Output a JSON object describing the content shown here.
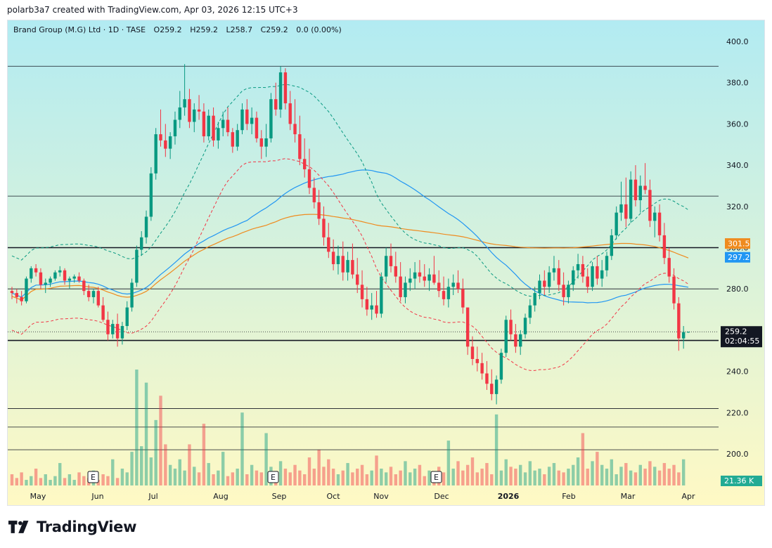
{
  "header": {
    "credit": "polarb3a7 created with TradingView.com, Apr 03, 2026 12:15 UTC+3"
  },
  "legend": {
    "symbol": "Brand Group (M.G) Ltd · 1D · TASE",
    "open": "O259.2",
    "high": "H259.2",
    "low": "L258.7",
    "close": "C259.2",
    "change": "0.0 (0.00%)"
  },
  "brand": {
    "name": "TradingView"
  },
  "colors": {
    "up": "#089981",
    "down": "#f23645",
    "sma_blue": "#2196f3",
    "sma_orange": "#ef8b1f",
    "band_green": "#089981",
    "band_red": "#f23645",
    "bg_top": "#b2ebf2",
    "bg_bottom": "#fff9c4"
  },
  "chart_data": {
    "type": "candlestick",
    "ylim": [
      190,
      405
    ],
    "y_ticks": [
      "400.0",
      "380.0",
      "360.0",
      "340.0",
      "320.0",
      "300.0",
      "280.0",
      "260.0",
      "240.0",
      "220.0",
      "200.0"
    ],
    "x_ticks": [
      "May",
      "Jun",
      "Jul",
      "Aug",
      "Sep",
      "Oct",
      "Nov",
      "Dec",
      "2026",
      "Feb",
      "Mar",
      "Apr"
    ],
    "horizontal_levels": [
      388,
      325,
      300,
      280,
      255,
      222,
      213,
      202
    ],
    "last_price": {
      "value": 259.2,
      "label": "259.2",
      "countdown": "02:04:55"
    },
    "sma_badges": [
      {
        "label": "301.5",
        "value": 301.5,
        "color": "#ef8b1f"
      },
      {
        "label": "297.2",
        "value": 297.2,
        "color": "#2196f3"
      }
    ],
    "volume_badge": "21.36 K",
    "event_markers": [
      "E",
      "E",
      "E"
    ],
    "candles": [
      [
        279,
        281,
        275,
        278
      ],
      [
        278,
        280,
        273,
        276
      ],
      [
        276,
        279,
        272,
        274
      ],
      [
        274,
        286,
        273,
        285
      ],
      [
        285,
        291,
        283,
        290
      ],
      [
        290,
        292,
        286,
        288
      ],
      [
        288,
        290,
        280,
        282
      ],
      [
        282,
        285,
        278,
        283
      ],
      [
        283,
        286,
        281,
        285
      ],
      [
        285,
        289,
        284,
        288
      ],
      [
        288,
        291,
        286,
        289
      ],
      [
        289,
        290,
        282,
        284
      ],
      [
        284,
        286,
        280,
        285
      ],
      [
        285,
        287,
        283,
        286
      ],
      [
        286,
        288,
        283,
        284
      ],
      [
        284,
        285,
        277,
        279
      ],
      [
        279,
        282,
        274,
        276
      ],
      [
        276,
        280,
        273,
        279
      ],
      [
        279,
        281,
        271,
        272
      ],
      [
        272,
        276,
        264,
        265
      ],
      [
        265,
        269,
        255,
        258
      ],
      [
        258,
        265,
        256,
        263
      ],
      [
        263,
        268,
        252,
        256
      ],
      [
        256,
        264,
        253,
        262
      ],
      [
        262,
        274,
        260,
        271
      ],
      [
        271,
        285,
        269,
        283
      ],
      [
        283,
        301,
        281,
        299
      ],
      [
        299,
        308,
        296,
        305
      ],
      [
        305,
        318,
        302,
        315
      ],
      [
        315,
        339,
        313,
        336
      ],
      [
        336,
        358,
        333,
        355
      ],
      [
        355,
        367,
        349,
        352
      ],
      [
        352,
        360,
        344,
        348
      ],
      [
        348,
        356,
        343,
        354
      ],
      [
        354,
        366,
        350,
        362
      ],
      [
        362,
        376,
        358,
        368
      ],
      [
        368,
        389,
        364,
        372
      ],
      [
        372,
        377,
        358,
        361
      ],
      [
        361,
        370,
        356,
        367
      ],
      [
        367,
        374,
        362,
        366
      ],
      [
        366,
        370,
        351,
        354
      ],
      [
        354,
        367,
        352,
        364
      ],
      [
        364,
        368,
        349,
        352
      ],
      [
        352,
        361,
        348,
        358
      ],
      [
        358,
        366,
        354,
        362
      ],
      [
        362,
        368,
        354,
        356
      ],
      [
        356,
        358,
        346,
        349
      ],
      [
        349,
        360,
        347,
        357
      ],
      [
        357,
        370,
        355,
        367
      ],
      [
        367,
        372,
        357,
        360
      ],
      [
        360,
        368,
        355,
        363
      ],
      [
        363,
        366,
        351,
        353
      ],
      [
        353,
        357,
        343,
        349
      ],
      [
        349,
        360,
        344,
        353
      ],
      [
        353,
        375,
        351,
        372
      ],
      [
        372,
        380,
        364,
        367
      ],
      [
        367,
        388,
        363,
        385
      ],
      [
        385,
        387,
        367,
        370
      ],
      [
        370,
        376,
        357,
        360
      ],
      [
        360,
        372,
        351,
        355
      ],
      [
        355,
        364,
        340,
        343
      ],
      [
        343,
        353,
        334,
        338
      ],
      [
        338,
        348,
        326,
        329
      ],
      [
        329,
        334,
        319,
        322
      ],
      [
        322,
        328,
        311,
        314
      ],
      [
        314,
        320,
        301,
        305
      ],
      [
        305,
        312,
        295,
        298
      ],
      [
        298,
        304,
        289,
        292
      ],
      [
        292,
        301,
        287,
        296
      ],
      [
        296,
        303,
        284,
        288
      ],
      [
        288,
        298,
        284,
        294
      ],
      [
        294,
        302,
        285,
        287
      ],
      [
        287,
        295,
        278,
        282
      ],
      [
        282,
        289,
        271,
        275
      ],
      [
        275,
        281,
        267,
        270
      ],
      [
        270,
        278,
        265,
        272
      ],
      [
        272,
        279,
        266,
        268
      ],
      [
        268,
        288,
        266,
        286
      ],
      [
        286,
        300,
        283,
        296
      ],
      [
        296,
        302,
        288,
        291
      ],
      [
        291,
        298,
        283,
        286
      ],
      [
        286,
        293,
        274,
        276
      ],
      [
        276,
        286,
        273,
        283
      ],
      [
        283,
        290,
        279,
        285
      ],
      [
        285,
        293,
        280,
        288
      ],
      [
        288,
        294,
        283,
        286
      ],
      [
        286,
        292,
        281,
        284
      ],
      [
        284,
        290,
        279,
        287
      ],
      [
        287,
        296,
        282,
        283
      ],
      [
        283,
        289,
        276,
        279
      ],
      [
        279,
        286,
        272,
        275
      ],
      [
        275,
        285,
        271,
        281
      ],
      [
        281,
        287,
        277,
        283
      ],
      [
        283,
        289,
        278,
        280
      ],
      [
        280,
        285,
        268,
        271
      ],
      [
        271,
        265,
        248,
        252
      ],
      [
        252,
        257,
        243,
        246
      ],
      [
        246,
        252,
        240,
        244
      ],
      [
        244,
        249,
        236,
        239
      ],
      [
        239,
        245,
        231,
        234
      ],
      [
        234,
        241,
        226,
        229
      ],
      [
        229,
        238,
        224,
        236
      ],
      [
        236,
        251,
        234,
        249
      ],
      [
        249,
        267,
        247,
        265
      ],
      [
        265,
        270,
        255,
        258
      ],
      [
        258,
        263,
        249,
        252
      ],
      [
        252,
        260,
        248,
        258
      ],
      [
        258,
        268,
        256,
        266
      ],
      [
        266,
        275,
        263,
        272
      ],
      [
        272,
        281,
        269,
        278
      ],
      [
        278,
        287,
        275,
        284
      ],
      [
        284,
        289,
        277,
        281
      ],
      [
        281,
        291,
        278,
        288
      ],
      [
        288,
        296,
        284,
        290
      ],
      [
        290,
        294,
        279,
        282
      ],
      [
        282,
        288,
        272,
        276
      ],
      [
        276,
        284,
        273,
        282
      ],
      [
        282,
        291,
        279,
        289
      ],
      [
        289,
        297,
        285,
        292
      ],
      [
        292,
        296,
        283,
        286
      ],
      [
        286,
        290,
        278,
        281
      ],
      [
        281,
        293,
        279,
        291
      ],
      [
        291,
        296,
        282,
        285
      ],
      [
        285,
        294,
        281,
        289
      ],
      [
        289,
        298,
        286,
        296
      ],
      [
        296,
        309,
        294,
        306
      ],
      [
        306,
        320,
        304,
        317
      ],
      [
        317,
        332,
        313,
        321
      ],
      [
        321,
        334,
        310,
        314
      ],
      [
        314,
        337,
        312,
        333
      ],
      [
        333,
        340,
        320,
        323
      ],
      [
        323,
        335,
        317,
        330
      ],
      [
        330,
        341,
        326,
        328
      ],
      [
        328,
        333,
        310,
        313
      ],
      [
        313,
        320,
        305,
        317
      ],
      [
        317,
        321,
        303,
        306
      ],
      [
        306,
        312,
        292,
        295
      ],
      [
        295,
        300,
        283,
        286
      ],
      [
        286,
        290,
        270,
        273
      ],
      [
        273,
        276,
        250,
        256
      ],
      [
        256,
        262,
        251,
        259
      ],
      [
        259,
        259.2,
        258.7,
        259.2
      ]
    ],
    "volumes": [
      6,
      4,
      7,
      3,
      5,
      9,
      4,
      6,
      3,
      5,
      12,
      4,
      6,
      3,
      7,
      5,
      4,
      8,
      3,
      6,
      5,
      14,
      4,
      9,
      7,
      18,
      62,
      21,
      55,
      15,
      35,
      48,
      22,
      11,
      9,
      14,
      8,
      22,
      10,
      7,
      33,
      12,
      6,
      8,
      18,
      5,
      7,
      9,
      39,
      6,
      11,
      8,
      7,
      28,
      10,
      6,
      13,
      9,
      7,
      11,
      8,
      6,
      15,
      9,
      19,
      10,
      14,
      9,
      6,
      8,
      12,
      7,
      9,
      11,
      6,
      8,
      16,
      9,
      7,
      10,
      6,
      8,
      13,
      7,
      9,
      11,
      5,
      8,
      6,
      10,
      7,
      24,
      9,
      13,
      8,
      11,
      15,
      7,
      9,
      12,
      6,
      38,
      8,
      14,
      10,
      9,
      11,
      7,
      13,
      8,
      9,
      6,
      10,
      12,
      8,
      7,
      9,
      11,
      15,
      28,
      9,
      13,
      18,
      11,
      9,
      14,
      6,
      10,
      12,
      8,
      7,
      11,
      9,
      13,
      10,
      8,
      12,
      9,
      11,
      7,
      14
    ]
  }
}
